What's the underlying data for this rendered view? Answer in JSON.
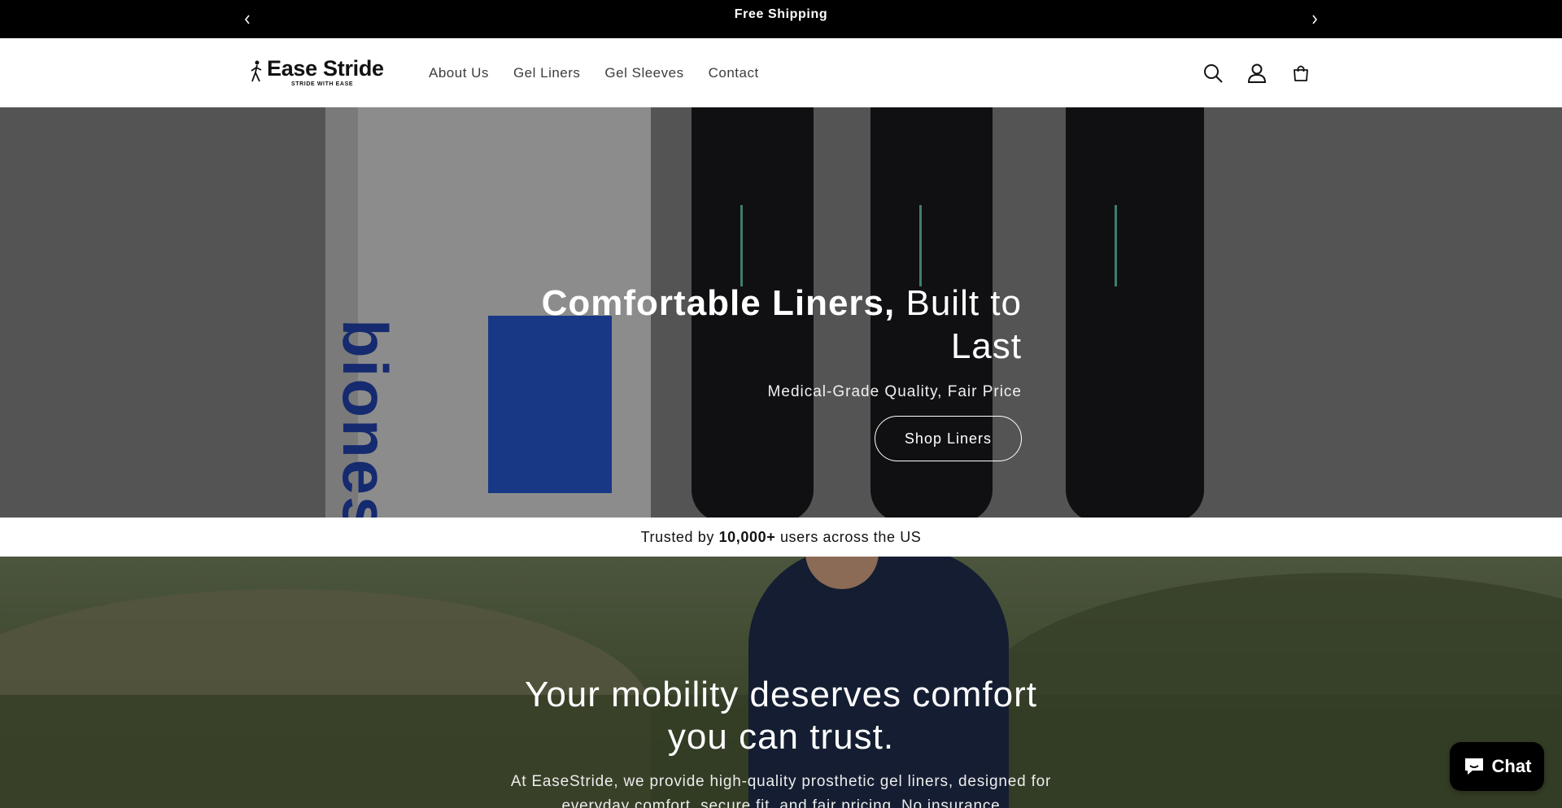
{
  "announcement": {
    "message": "Free Shipping"
  },
  "header": {
    "logo": {
      "name": "Ease Stride",
      "tagline": "STRIDE WITH EASE"
    },
    "nav": [
      {
        "label": "About Us"
      },
      {
        "label": "Gel Liners"
      },
      {
        "label": "Gel Sleeves"
      },
      {
        "label": "Contact"
      }
    ],
    "icons": [
      "search-icon",
      "account-icon",
      "cart-icon"
    ]
  },
  "hero": {
    "title_bold": "Comfortable Liners,",
    "title_rest": " Built to Last",
    "subtitle": "Medical-Grade Quality, Fair Price",
    "button": "Shop Liners",
    "box_text": "bionest"
  },
  "trust": {
    "prefix": "Trusted by ",
    "count": "10,000+",
    "suffix": " users across the US"
  },
  "mobility": {
    "heading": "Your mobility deserves comfort you can trust.",
    "body": "At EaseStride, we provide high-quality prosthetic gel liners, designed for everyday comfort, secure fit, and fair pricing. No insurance"
  },
  "chat": {
    "label": "Chat"
  },
  "colors": {
    "announcement_bg": "#000000",
    "box_blue": "#2453c6"
  }
}
